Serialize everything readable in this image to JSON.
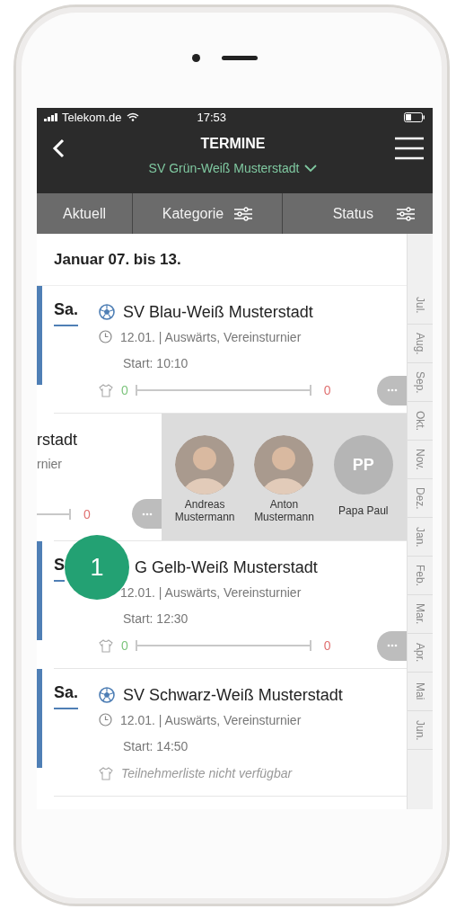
{
  "status_bar": {
    "carrier": "Telekom.de",
    "time": "17:53"
  },
  "header": {
    "title": "TERMINE",
    "club": "SV Grün-Weiß Musterstadt"
  },
  "filters": [
    {
      "label": "Aktuell",
      "kind": "plain"
    },
    {
      "label": "Kategorie",
      "kind": "filter"
    },
    {
      "label": "Status",
      "kind": "filter"
    }
  ],
  "week_heading": "Januar 07. bis 13.",
  "events": [
    {
      "kind": "full",
      "day": "Sa.",
      "sport_icon": true,
      "title": "SV Blau-Weiß Musterstadt",
      "info": "12.01. | Auswärts, Vereinsturnier",
      "start": "Start: 10:10",
      "yes_count": "0",
      "no_count": "0"
    },
    {
      "kind": "swiped",
      "title": "rstadt",
      "info": "rnier",
      "no_count": "0",
      "participants": [
        {
          "kind": "photo",
          "name": "Andreas Mustermann"
        },
        {
          "kind": "photo",
          "name": "Anton Mustermann"
        },
        {
          "kind": "initials",
          "initials": "PP",
          "name": "Papa Paul"
        }
      ]
    },
    {
      "kind": "full",
      "day": "S",
      "sport_icon": false,
      "title": "G Gelb-Weiß Musterstadt",
      "info": "12.01. | Auswärts, Vereinsturnier",
      "start": "Start: 12:30",
      "yes_count": "0",
      "no_count": "0",
      "badge": "1"
    },
    {
      "kind": "unavailable",
      "day": "Sa.",
      "sport_icon": true,
      "title": "SV Schwarz-Weiß Musterstadt",
      "info": "12.01. | Auswärts, Vereinsturnier",
      "start": "Start: 14:50",
      "note": "Teilnehmerliste nicht verfügbar"
    }
  ],
  "months": [
    "Jul.",
    "Aug.",
    "Sep.",
    "Okt.",
    "Nov.",
    "Dez.",
    "Jan.",
    "Feb.",
    "Mar.",
    "Apr.",
    "Mai",
    "Jun."
  ]
}
